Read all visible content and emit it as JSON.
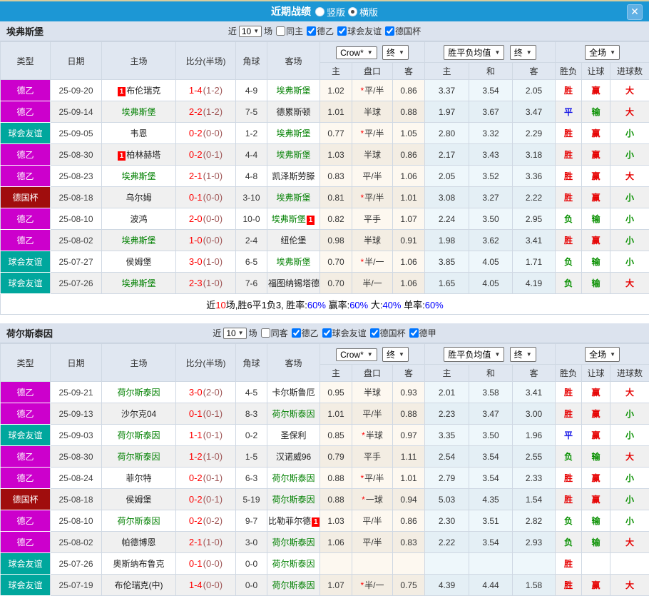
{
  "titlebar": {
    "title": "近期战绩",
    "vertical_label": "竖版",
    "horizontal_label": "横版",
    "close_label": "✕",
    "bar_color": "#1C97D5"
  },
  "type_colors": {
    "德乙": "#CC00CC",
    "球会友谊": "#00A79D",
    "德国杯": "#A00D0D",
    "德甲": "#CC00CC"
  },
  "result_colors": {
    "胜": "#E60000",
    "平": "#1414E6",
    "负": "#089000",
    "赢": "#E60000",
    "输": "#089000",
    "大": "#E60000",
    "小": "#089000"
  },
  "table_header": {
    "main": [
      "类型",
      "日期",
      "主场",
      "比分(半场)",
      "角球",
      "客场"
    ],
    "sub": [
      "主",
      "盘口",
      "客",
      "主",
      "和",
      "客",
      "胜负",
      "让球",
      "进球数"
    ],
    "selects": {
      "company": "Crow*",
      "final1": "终",
      "avg": "胜平负均值",
      "final2": "终",
      "scope": "全场"
    }
  },
  "sections": [
    {
      "team": "埃弗斯堡",
      "filters": {
        "near": "近",
        "count": "10",
        "games": "场",
        "same": {
          "label": "同主",
          "checked": false
        },
        "leagues": [
          {
            "label": "德乙",
            "checked": true
          },
          {
            "label": "球会友谊",
            "checked": true
          },
          {
            "label": "德国杯",
            "checked": true
          }
        ]
      },
      "rows": [
        {
          "type": "德乙",
          "date": "25-09-20",
          "home": "布伦瑞克",
          "home_rc_pre": "1",
          "ft": "1-4",
          "ht": "(1-2)",
          "corner": "4-9",
          "away": "埃弗斯堡",
          "away_g": 1,
          "hh": "1.02",
          "star": 1,
          "line": "平/半",
          "ha": "0.86",
          "eh": "3.37",
          "ed": "3.54",
          "ea": "2.05",
          "res": "胜",
          "hres": "赢",
          "goals": "大"
        },
        {
          "type": "德乙",
          "date": "25-09-14",
          "home": "埃弗斯堡",
          "home_g": 1,
          "ft": "2-2",
          "ht": "(1-2)",
          "corner": "7-5",
          "away": "德累斯顿",
          "hh": "1.01",
          "line": "半球",
          "ha": "0.88",
          "eh": "1.97",
          "ed": "3.67",
          "ea": "3.47",
          "res": "平",
          "hres": "输",
          "goals": "大"
        },
        {
          "type": "球会友谊",
          "date": "25-09-05",
          "home": "韦恩",
          "ft": "0-2",
          "ht": "(0-0)",
          "corner": "1-2",
          "away": "埃弗斯堡",
          "away_g": 1,
          "hh": "0.77",
          "star": 1,
          "line": "平/半",
          "ha": "1.05",
          "eh": "2.80",
          "ed": "3.32",
          "ea": "2.29",
          "res": "胜",
          "hres": "赢",
          "goals": "小"
        },
        {
          "type": "德乙",
          "date": "25-08-30",
          "home": "柏林赫塔",
          "home_rc_pre": "1",
          "ft": "0-2",
          "ht": "(0-1)",
          "corner": "4-4",
          "away": "埃弗斯堡",
          "away_g": 1,
          "hh": "1.03",
          "line": "半球",
          "ha": "0.86",
          "eh": "2.17",
          "ed": "3.43",
          "ea": "3.18",
          "res": "胜",
          "hres": "赢",
          "goals": "小"
        },
        {
          "type": "德乙",
          "date": "25-08-23",
          "home": "埃弗斯堡",
          "home_g": 1,
          "ft": "2-1",
          "ht": "(1-0)",
          "corner": "4-8",
          "away": "凯泽斯劳滕",
          "hh": "0.83",
          "line": "平/半",
          "ha": "1.06",
          "eh": "2.05",
          "ed": "3.52",
          "ea": "3.36",
          "res": "胜",
          "hres": "赢",
          "goals": "大"
        },
        {
          "type": "德国杯",
          "date": "25-08-18",
          "home": "乌尔姆",
          "ft": "0-1",
          "ht": "(0-0)",
          "corner": "3-10",
          "away": "埃弗斯堡",
          "away_g": 1,
          "hh": "0.81",
          "star": 1,
          "line": "平/半",
          "ha": "1.01",
          "eh": "3.08",
          "ed": "3.27",
          "ea": "2.22",
          "res": "胜",
          "hres": "赢",
          "goals": "小"
        },
        {
          "type": "德乙",
          "date": "25-08-10",
          "home": "波鸿",
          "ft": "2-0",
          "ht": "(0-0)",
          "corner": "10-0",
          "away": "埃弗斯堡",
          "away_g": 1,
          "away_rc_post": "1",
          "hh": "0.82",
          "line": "平手",
          "ha": "1.07",
          "eh": "2.24",
          "ed": "3.50",
          "ea": "2.95",
          "res": "负",
          "hres": "输",
          "goals": "小"
        },
        {
          "type": "德乙",
          "date": "25-08-02",
          "home": "埃弗斯堡",
          "home_g": 1,
          "ft": "1-0",
          "ht": "(0-0)",
          "corner": "2-4",
          "away": "纽伦堡",
          "hh": "0.98",
          "line": "半球",
          "ha": "0.91",
          "eh": "1.98",
          "ed": "3.62",
          "ea": "3.41",
          "res": "胜",
          "hres": "赢",
          "goals": "小"
        },
        {
          "type": "球会友谊",
          "date": "25-07-27",
          "home": "侯姆堡",
          "ft": "3-0",
          "ht": "(1-0)",
          "corner": "6-5",
          "away": "埃弗斯堡",
          "away_g": 1,
          "hh": "0.70",
          "star": 1,
          "line": "半/一",
          "ha": "1.06",
          "eh": "3.85",
          "ed": "4.05",
          "ea": "1.71",
          "res": "负",
          "hres": "输",
          "goals": "小"
        },
        {
          "type": "球会友谊",
          "date": "25-07-26",
          "home": "埃弗斯堡",
          "home_g": 1,
          "ft": "2-3",
          "ht": "(1-0)",
          "corner": "7-6",
          "away": "福图纳锡塔德",
          "hh": "0.70",
          "line": "半/一",
          "ha": "1.06",
          "eh": "1.65",
          "ed": "4.05",
          "ea": "4.19",
          "res": "负",
          "hres": "输",
          "goals": "大"
        }
      ],
      "summary": [
        {
          "t": "近"
        },
        {
          "t": "10",
          "c": "#FF0000"
        },
        {
          "t": "场,胜6平1负3, 胜率:"
        },
        {
          "t": "60%",
          "c": "#0000FF"
        },
        {
          "t": " 赢率:"
        },
        {
          "t": "60%",
          "c": "#0000FF"
        },
        {
          "t": " 大:"
        },
        {
          "t": "40%",
          "c": "#0000FF"
        },
        {
          "t": " 单率:"
        },
        {
          "t": "60%",
          "c": "#0000FF"
        }
      ]
    },
    {
      "team": "荷尔斯泰因",
      "filters": {
        "near": "近",
        "count": "10",
        "games": "场",
        "same": {
          "label": "同客",
          "checked": false
        },
        "leagues": [
          {
            "label": "德乙",
            "checked": true
          },
          {
            "label": "球会友谊",
            "checked": true
          },
          {
            "label": "德国杯",
            "checked": true
          },
          {
            "label": "德甲",
            "checked": true
          }
        ]
      },
      "rows": [
        {
          "type": "德乙",
          "date": "25-09-21",
          "home": "荷尔斯泰因",
          "home_g": 1,
          "ft": "3-0",
          "ht": "(2-0)",
          "corner": "4-5",
          "away": "卡尔斯鲁厄",
          "hh": "0.95",
          "line": "半球",
          "ha": "0.93",
          "eh": "2.01",
          "ed": "3.58",
          "ea": "3.41",
          "res": "胜",
          "hres": "赢",
          "goals": "大"
        },
        {
          "type": "德乙",
          "date": "25-09-13",
          "home": "沙尔克04",
          "ft": "0-1",
          "ht": "(0-1)",
          "corner": "8-3",
          "away": "荷尔斯泰因",
          "away_g": 1,
          "hh": "1.01",
          "line": "平/半",
          "ha": "0.88",
          "eh": "2.23",
          "ed": "3.47",
          "ea": "3.00",
          "res": "胜",
          "hres": "赢",
          "goals": "小"
        },
        {
          "type": "球会友谊",
          "date": "25-09-03",
          "home": "荷尔斯泰因",
          "home_g": 1,
          "ft": "1-1",
          "ht": "(0-1)",
          "corner": "0-2",
          "away": "圣保利",
          "hh": "0.85",
          "star": 1,
          "line": "半球",
          "ha": "0.97",
          "eh": "3.35",
          "ed": "3.50",
          "ea": "1.96",
          "res": "平",
          "hres": "赢",
          "goals": "小"
        },
        {
          "type": "德乙",
          "date": "25-08-30",
          "home": "荷尔斯泰因",
          "home_g": 1,
          "ft": "1-2",
          "ht": "(1-0)",
          "corner": "1-5",
          "away": "汉诺威96",
          "hh": "0.79",
          "line": "平手",
          "ha": "1.11",
          "eh": "2.54",
          "ed": "3.54",
          "ea": "2.55",
          "res": "负",
          "hres": "输",
          "goals": "大"
        },
        {
          "type": "德乙",
          "date": "25-08-24",
          "home": "菲尔特",
          "ft": "0-2",
          "ht": "(0-1)",
          "corner": "6-3",
          "away": "荷尔斯泰因",
          "away_g": 1,
          "hh": "0.88",
          "star": 1,
          "line": "平/半",
          "ha": "1.01",
          "eh": "2.79",
          "ed": "3.54",
          "ea": "2.33",
          "res": "胜",
          "hres": "赢",
          "goals": "小"
        },
        {
          "type": "德国杯",
          "date": "25-08-18",
          "home": "侯姆堡",
          "ft": "0-2",
          "ht": "(0-1)",
          "corner": "5-19",
          "away": "荷尔斯泰因",
          "away_g": 1,
          "hh": "0.88",
          "star": 1,
          "line": "一球",
          "ha": "0.94",
          "eh": "5.03",
          "ed": "4.35",
          "ea": "1.54",
          "res": "胜",
          "hres": "赢",
          "goals": "小"
        },
        {
          "type": "德乙",
          "date": "25-08-10",
          "home": "荷尔斯泰因",
          "home_g": 1,
          "ft": "0-2",
          "ht": "(0-2)",
          "corner": "9-7",
          "away": "比勒菲尔德",
          "away_rc_post": "1",
          "hh": "1.03",
          "line": "平/半",
          "ha": "0.86",
          "eh": "2.30",
          "ed": "3.51",
          "ea": "2.82",
          "res": "负",
          "hres": "输",
          "goals": "小"
        },
        {
          "type": "德乙",
          "date": "25-08-02",
          "home": "帕德博恩",
          "ft": "2-1",
          "ht": "(1-0)",
          "corner": "3-0",
          "away": "荷尔斯泰因",
          "away_g": 1,
          "hh": "1.06",
          "line": "平/半",
          "ha": "0.83",
          "eh": "2.22",
          "ed": "3.54",
          "ea": "2.93",
          "res": "负",
          "hres": "输",
          "goals": "大"
        },
        {
          "type": "球会友谊",
          "date": "25-07-26",
          "home": "奥斯纳布鲁克",
          "ft": "0-1",
          "ht": "(0-0)",
          "corner": "0-0",
          "away": "荷尔斯泰因",
          "away_g": 1,
          "res": "胜"
        },
        {
          "type": "球会友谊",
          "date": "25-07-19",
          "home": "布伦瑞克(中)",
          "ft": "1-4",
          "ht": "(0-0)",
          "corner": "0-0",
          "away": "荷尔斯泰因",
          "away_g": 1,
          "hh": "1.07",
          "star": 1,
          "line": "半/一",
          "ha": "0.75",
          "eh": "4.39",
          "ed": "4.44",
          "ea": "1.58",
          "res": "胜",
          "hres": "赢",
          "goals": "大"
        }
      ]
    }
  ]
}
